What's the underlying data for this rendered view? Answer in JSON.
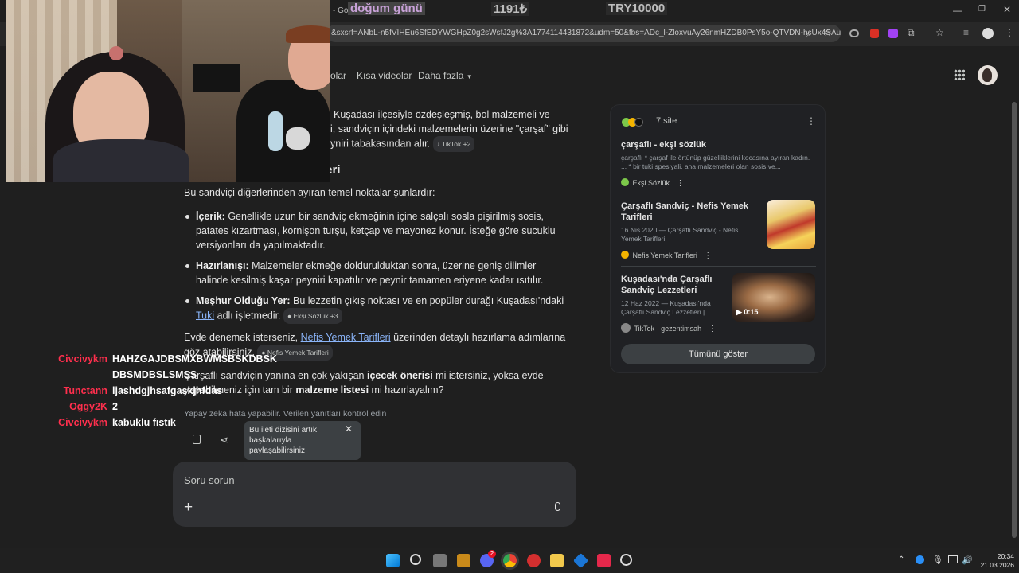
{
  "browser": {
    "tab_fragment": "- Goo",
    "url": "&sxsrf=ANbL-n5fVIHEu6SfEDYWGHpZ0g2sWsfJ2g%3A1774114431872&udm=50&fbs=ADc_l-ZloxvuAy26nmHZDB0PsY5o-QTVDN-hcUx4SAu..."
  },
  "stream_overlay": {
    "goal_label": "doğum günü",
    "goal_amount": "1191₺",
    "goal_target": "TRY10000"
  },
  "google": {
    "nav": [
      "olar",
      "Kısa videolar",
      "Daha fazla"
    ],
    "intro_lines": [
      "Kuşadası ilçesiyle özdeşleşmiş, bol malzemeli ve",
      "i, sandviçin içindeki malzemelerin üzerine \"çarşaf\" gibi",
      "yniri tabakasından alır."
    ],
    "intro_chip": "TikTok +2",
    "section_heading_fragment": "leri",
    "lead": "Bu sandviçi diğerlerinden ayıran temel noktalar şunlardır:",
    "bullets": [
      {
        "label": "İçerik:",
        "text": " Genellikle uzun bir sandviç ekmeğinin içine salçalı sosla pişirilmiş sosis, patates kızartması, kornişon turşu, ketçap ve mayonez konur. İsteğe göre sucuklu versiyonları da yapılmaktadır."
      },
      {
        "label": "Hazırlanışı:",
        "text": " Malzemeler ekmeğe doldurulduktan sonra, üzerine geniş dilimler halinde kesilmiş kaşar peyniri kapatılır ve peynir tamamen eriyene kadar ısıtılır."
      },
      {
        "label": "Meşhur Olduğu Yer:",
        "text": " Bu lezzetin çıkış noktası ve en popüler durağı Kuşadası'ndaki ",
        "link": "Tuki",
        "tail": " adlı işletmedir.",
        "chip": "Ekşi Sözlük +3"
      }
    ],
    "recipe_pre": "Evde denemek isterseniz, ",
    "recipe_link": "Nefis Yemek Tarifleri",
    "recipe_post": " üzerinden detaylı hazırlama adımlarına göz atabilirsiniz.",
    "recipe_chip": "Nefis Yemek Tarifleri",
    "followup_a": "Çarşaflı sandviçin yanına en çok yakışan ",
    "followup_b": "içecek önerisi",
    "followup_c": " mi istersiniz, yoksa evde yapabilmeniz için tam bir ",
    "followup_d": "malzeme listesi",
    "followup_e": " mi hazırlayalım?",
    "disclaimer": "Yapay zeka hata yapabilir. Verilen yanıtları kontrol edin",
    "share_tooltip": "Bu ileti dizisini artık başkalarıyla paylaşabilirsiniz",
    "ask_placeholder": "Soru sorun",
    "sources_count": "7 site",
    "sources": [
      {
        "title": "çarşaflı - ekşi sözlük",
        "snippet": "çarşaflı * çarşaf ile örtünüp güzelliklerini kocasına ayıran kadın. ... * bir tuki spesiyali. ana malzemeleri olan sosis ve...",
        "site": "Ekşi Sözlük",
        "dot": "#7cc84a"
      },
      {
        "title": "Çarşaflı Sandviç - Nefis Yemek Tarifleri",
        "snippet": "16 Nis 2020 — Çarşaflı Sandviç - Nefis Yemek Tarifleri.",
        "site": "Nefis Yemek Tarifleri",
        "dot": "#f4b400"
      },
      {
        "title": "Kuşadası'nda Çarşaflı Sandviç Lezzetleri",
        "snippet": "12 Haz 2022 — Kuşadası'nda Çarşaflı Sandviç Lezzetleri |...",
        "site": "TikTok · gezentimsah",
        "dot": "#888888",
        "duration": "0:15"
      }
    ],
    "show_all": "Tümünü göster"
  },
  "chat": [
    {
      "user": "Civcivykm",
      "msg": "HAHZGAJDBSMXBWMSBSKDBSK"
    },
    {
      "user": "",
      "msg": "DBSMDBSLSMSS"
    },
    {
      "user": "Tunctann",
      "msg": "ljashdgjhsafgaskjhfdas"
    },
    {
      "user": "Oggy2K",
      "msg": "2"
    },
    {
      "user": "Civcivykm",
      "msg": "kabuklu fıstık"
    }
  ],
  "taskbar": {
    "time": "20:34",
    "date": "21.03.2026",
    "discord_badge": "2"
  }
}
